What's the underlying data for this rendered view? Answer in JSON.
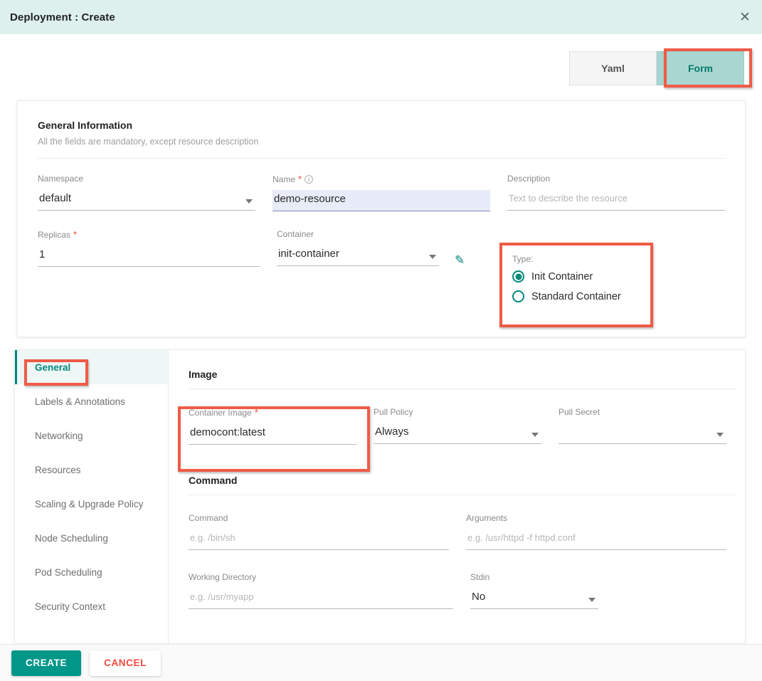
{
  "window": {
    "title": "Deployment : Create",
    "close_icon": "close-icon"
  },
  "tabs": [
    {
      "label": "Yaml",
      "active": false
    },
    {
      "label": "Form",
      "active": true
    }
  ],
  "general": {
    "heading": "General Information",
    "subheading": "All the fields are mandatory, except resource description",
    "fields": {
      "namespace": {
        "label": "Namespace",
        "value": "default"
      },
      "name": {
        "label": "Name",
        "required": "*",
        "info_icon": "info-icon",
        "value": "demo-resource"
      },
      "description": {
        "label": "Description",
        "placeholder": "Text to describe the resource",
        "value": ""
      },
      "replicas": {
        "label": "Replicas",
        "required": "*",
        "value": "1"
      },
      "container": {
        "label": "Container",
        "value": "init-container",
        "edit_icon": "pencil-icon"
      }
    },
    "type": {
      "label": "Type:",
      "options": [
        {
          "label": "Init Container",
          "selected": true
        },
        {
          "label": "Standard Container",
          "selected": false
        }
      ]
    }
  },
  "sidebar": {
    "items": [
      {
        "label": "General",
        "active": true
      },
      {
        "label": "Labels & Annotations",
        "active": false
      },
      {
        "label": "Networking",
        "active": false
      },
      {
        "label": "Resources",
        "active": false
      },
      {
        "label": "Scaling & Upgrade Policy",
        "active": false
      },
      {
        "label": "Node Scheduling",
        "active": false
      },
      {
        "label": "Pod Scheduling",
        "active": false
      },
      {
        "label": "Security Context",
        "active": false
      }
    ]
  },
  "detail": {
    "image_section": {
      "heading": "Image",
      "container_image": {
        "label": "Container Image",
        "required": "*",
        "value": "democont:latest"
      },
      "pull_policy": {
        "label": "Pull Policy",
        "value": "Always"
      },
      "pull_secret": {
        "label": "Pull Secret",
        "value": ""
      }
    },
    "command_section": {
      "heading": "Command",
      "command": {
        "label": "Command",
        "placeholder": "e.g. /bin/sh",
        "value": ""
      },
      "arguments": {
        "label": "Arguments",
        "placeholder": "e.g. /usr/httpd -f httpd.conf",
        "value": ""
      },
      "working_directory": {
        "label": "Working Directory",
        "placeholder": "e.g. /usr/myapp",
        "value": ""
      },
      "stdin": {
        "label": "Stdin",
        "value": "No"
      }
    }
  },
  "footer": {
    "create_label": "CREATE",
    "cancel_label": "CANCEL"
  },
  "colors": {
    "header_bg": "#DDF0EE",
    "accent_teal": "#00897B",
    "tab_active_bg": "#A9D6D1",
    "annotation_red": "#EF5B47",
    "required_red": "#F44336",
    "cancel_red": "#F4483B",
    "create_bg": "#009688",
    "focus_field_bg": "#E8EBF8"
  }
}
